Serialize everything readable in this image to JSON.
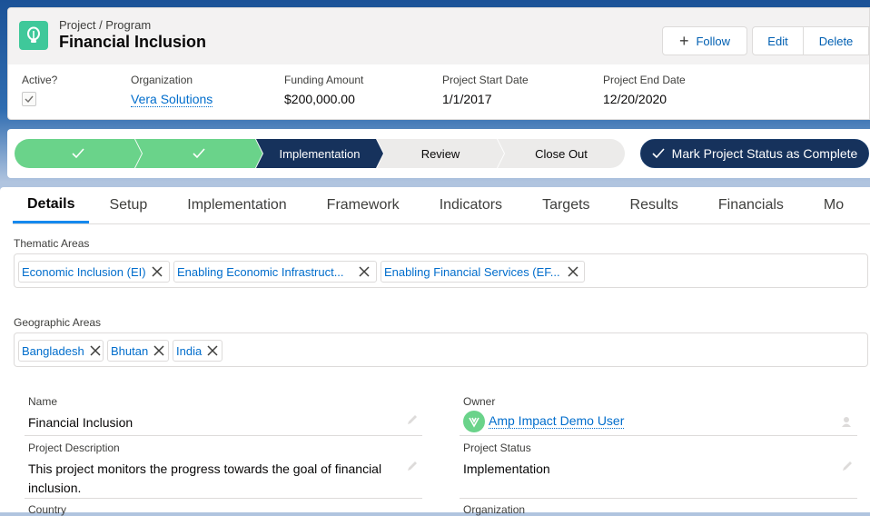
{
  "header": {
    "breadcrumb": "Project / Program",
    "title": "Financial Inclusion",
    "buttons": {
      "follow": "Follow",
      "edit": "Edit",
      "delete": "Delete"
    },
    "highlights": {
      "active_label": "Active?",
      "organization_label": "Organization",
      "organization_value": "Vera Solutions",
      "funding_label": "Funding Amount",
      "funding_value": "$200,000.00",
      "start_label": "Project Start Date",
      "start_value": "1/1/2017",
      "end_label": "Project End Date",
      "end_value": "12/20/2020"
    }
  },
  "path": {
    "stages": [
      {
        "label": "",
        "state": "done"
      },
      {
        "label": "",
        "state": "done"
      },
      {
        "label": "Implementation",
        "state": "current"
      },
      {
        "label": "Review",
        "state": "todo"
      },
      {
        "label": "Close Out",
        "state": "todo"
      }
    ],
    "complete_button": "Mark Project Status as Complete"
  },
  "tabs": [
    "Details",
    "Setup",
    "Implementation",
    "Framework",
    "Indicators",
    "Targets",
    "Results",
    "Financials",
    "Mo"
  ],
  "active_tab": "Details",
  "thematic": {
    "label": "Thematic Areas",
    "items": [
      "Economic Inclusion (EI)",
      "Enabling Economic Infrastruct...",
      "Enabling Financial Services (EF..."
    ]
  },
  "geographic": {
    "label": "Geographic Areas",
    "items": [
      "Bangladesh",
      "Bhutan",
      "India"
    ]
  },
  "fields": {
    "name_label": "Name",
    "name_value": "Financial Inclusion",
    "owner_label": "Owner",
    "owner_value": "Amp Impact Demo User",
    "desc_label": "Project Description",
    "desc_value": "This project monitors the progress towards the goal of financial inclusion.",
    "status_label": "Project Status",
    "status_value": "Implementation",
    "country_label": "Country",
    "org_label": "Organization"
  },
  "colors": {
    "brand_blue": "#16325c",
    "link": "#006dcc",
    "done_green": "#6ad38a",
    "icon_green": "#3fc89a"
  }
}
